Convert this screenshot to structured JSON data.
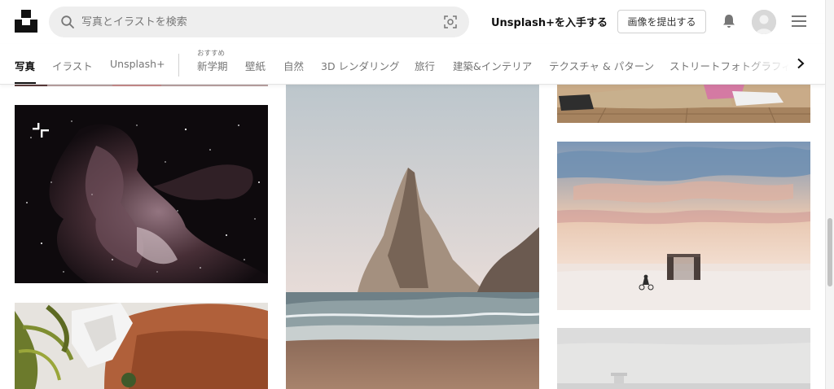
{
  "header": {
    "search_placeholder": "写真とイラストを検索",
    "plus_link": "Unsplash+を入手する",
    "submit_button": "画像を提出する"
  },
  "categories": {
    "recommend_label": "おすすめ",
    "items": [
      "写真",
      "イラスト",
      "Unsplash+",
      "新学期",
      "壁紙",
      "自然",
      "3D レンダリング",
      "旅行",
      "建築&インテリア",
      "テクスチャ & パターン",
      "ストリートフォトグラフィ"
    ]
  },
  "icons": {
    "logo": "unsplash-logo",
    "search": "search-icon",
    "visual_search": "visual-search-icon",
    "bell": "bell-icon",
    "menu": "hamburger-menu-icon",
    "next": "chevron-right-icon",
    "plus_badge": "unsplash-plus-badge-icon"
  },
  "colors": {
    "text_primary": "#111111",
    "text_secondary": "#767676",
    "search_bg": "#eeeeee",
    "border": "#d1d1d1"
  }
}
